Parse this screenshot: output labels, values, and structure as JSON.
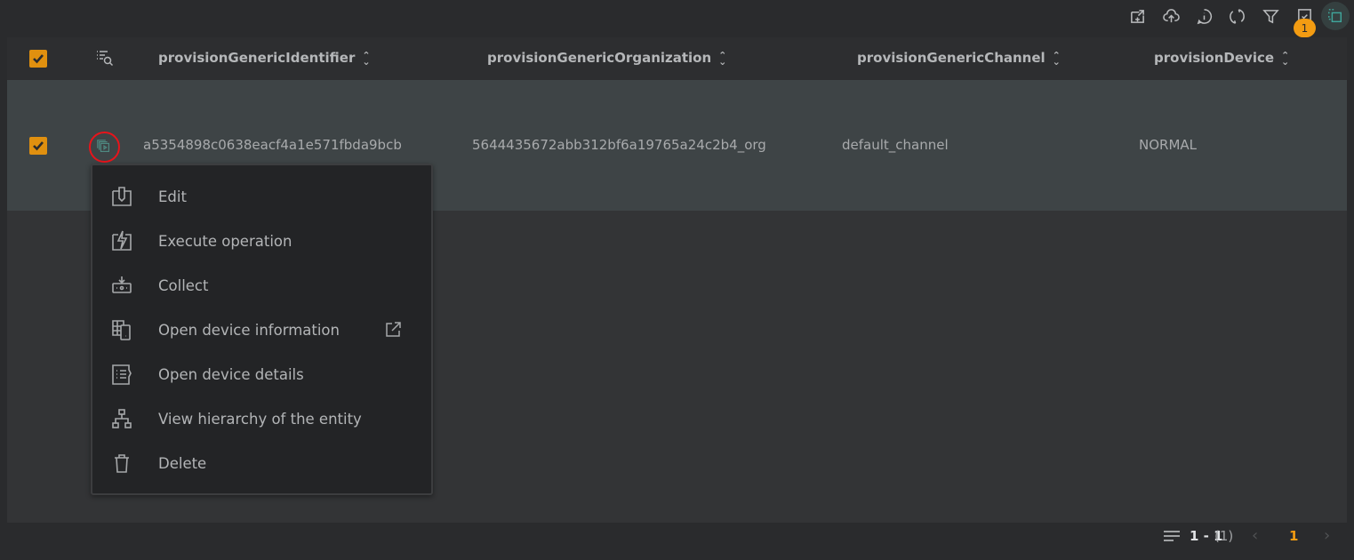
{
  "toolbar": {
    "icons": [
      "export-icon",
      "upload-icon",
      "info-icon",
      "refresh-icon",
      "filter-icon",
      "selected-items-icon",
      "multi-select-icon"
    ],
    "selected_count": "1"
  },
  "table": {
    "columns": [
      {
        "label": "provisionGenericIdentifier"
      },
      {
        "label": "provisionGenericOrganization"
      },
      {
        "label": "provisionGenericChannel"
      },
      {
        "label": "provisionDevice"
      }
    ],
    "rows": [
      {
        "selected": true,
        "cells": [
          "a5354898c0638eacf4a1e571fbda9bcb",
          "5644435672abb312bf6a19765a24c2b4_org",
          "default_channel",
          "NORMAL"
        ]
      }
    ]
  },
  "context_menu": {
    "items": [
      {
        "label": "Edit",
        "icon": "edit-icon"
      },
      {
        "label": "Execute operation",
        "icon": "execute-operation-icon"
      },
      {
        "label": "Collect",
        "icon": "collect-icon"
      },
      {
        "label": "Open device information",
        "icon": "device-info-icon",
        "external": true
      },
      {
        "label": "Open device details",
        "icon": "device-details-icon"
      },
      {
        "label": "View hierarchy of the entity",
        "icon": "hierarchy-icon"
      },
      {
        "label": "Delete",
        "icon": "trash-icon"
      }
    ]
  },
  "pagination": {
    "range": "1 - 1",
    "total": "(1)",
    "current_page": "1"
  },
  "colors": {
    "accent": "#f39c12",
    "checkbox": "#e0900f",
    "selected_row": "#3e4446",
    "menu_bg": "#232426",
    "highlight_circle": "#e8141b"
  }
}
